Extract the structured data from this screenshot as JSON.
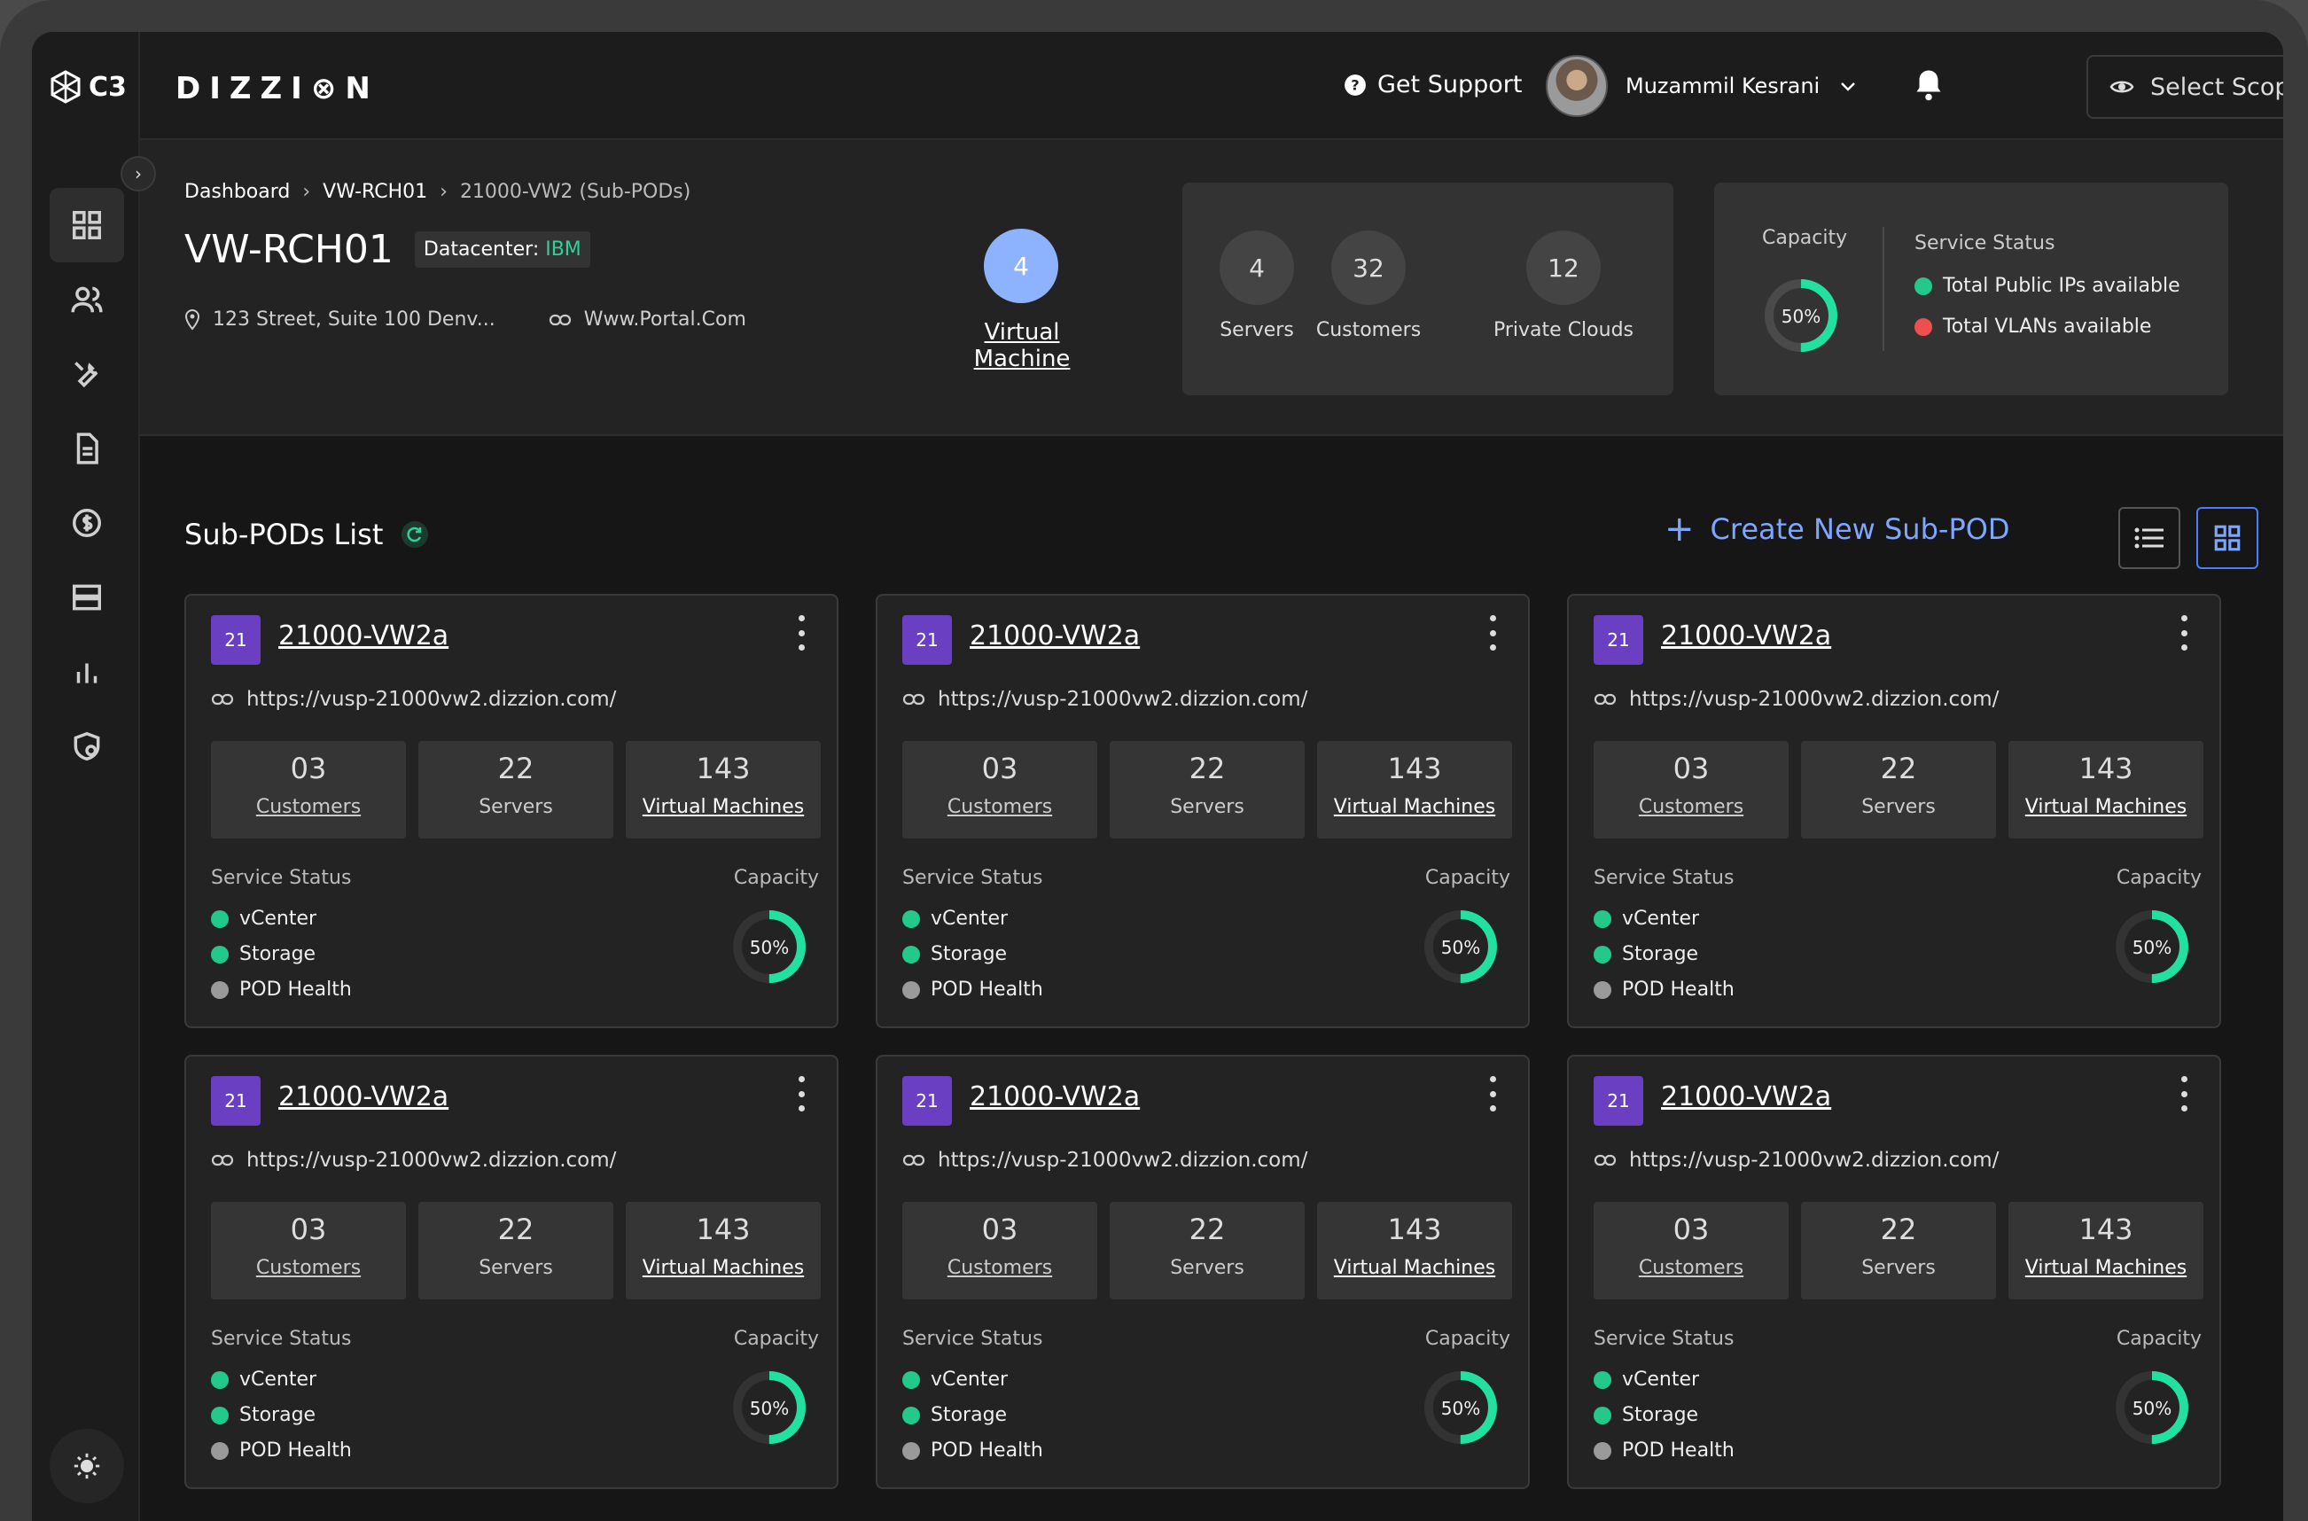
{
  "app": {
    "logo_text": "C3",
    "brand": "DIZZI⊗N"
  },
  "topbar": {
    "support_label": "Get Support",
    "user_name": "Muzammil Kesrani",
    "scope_label": "Select Scope"
  },
  "sidebar": {
    "items": [
      {
        "icon": "dashboard-icon",
        "active": true
      },
      {
        "icon": "users-icon"
      },
      {
        "icon": "tools-icon"
      },
      {
        "icon": "document-icon"
      },
      {
        "icon": "billing-icon"
      },
      {
        "icon": "servers-icon"
      },
      {
        "icon": "chart-icon"
      },
      {
        "icon": "security-icon"
      }
    ]
  },
  "breadcrumb": {
    "items": [
      "Dashboard",
      "VW-RCH01",
      "21000-VW2 (Sub-PODs)"
    ]
  },
  "pod": {
    "title": "VW-RCH01",
    "datacenter_prefix": "Datacenter: ",
    "datacenter": "IBM",
    "address": "123 Street, Suite 100 Denv...",
    "website": "Www.Portal.Com",
    "vm_count": "4",
    "vm_label": "Virtual Machine"
  },
  "stats": {
    "servers": {
      "value": "4",
      "label": "Servers"
    },
    "customers": {
      "value": "32",
      "label": "Customers"
    },
    "private_clouds": {
      "value": "12",
      "label": "Private Clouds"
    }
  },
  "capacity_panel": {
    "title": "Capacity",
    "percent_text": "50%",
    "percent": 50,
    "service_status_title": "Service Status",
    "items": [
      {
        "label": "Total Public IPs available",
        "color": "#22c98a"
      },
      {
        "label": "Total VLANs available",
        "color": "#ef4f4f"
      }
    ]
  },
  "subpods": {
    "title": "Sub-PODs List",
    "create_label": "Create New Sub-POD",
    "cards": [
      {
        "badge": "21",
        "name": "21000-VW2a",
        "url": "https://vusp-21000vw2.dizzion.com/",
        "customers": "03",
        "customers_label": "Customers",
        "servers": "22",
        "servers_label": "Servers",
        "vms": "143",
        "vms_label": "Virtual Machines",
        "status_label": "Service Status",
        "capacity_label": "Capacity",
        "capacity_text": "50%",
        "capacity": 50,
        "services": [
          "vCenter",
          "Storage",
          "POD Health"
        ]
      },
      {
        "badge": "21",
        "name": "21000-VW2a",
        "url": "https://vusp-21000vw2.dizzion.com/",
        "customers": "03",
        "customers_label": "Customers",
        "servers": "22",
        "servers_label": "Servers",
        "vms": "143",
        "vms_label": "Virtual Machines",
        "status_label": "Service Status",
        "capacity_label": "Capacity",
        "capacity_text": "50%",
        "capacity": 50,
        "services": [
          "vCenter",
          "Storage",
          "POD Health"
        ]
      },
      {
        "badge": "21",
        "name": "21000-VW2a",
        "url": "https://vusp-21000vw2.dizzion.com/",
        "customers": "03",
        "customers_label": "Customers",
        "servers": "22",
        "servers_label": "Servers",
        "vms": "143",
        "vms_label": "Virtual Machines",
        "status_label": "Service Status",
        "capacity_label": "Capacity",
        "capacity_text": "50%",
        "capacity": 50,
        "services": [
          "vCenter",
          "Storage",
          "POD Health"
        ]
      },
      {
        "badge": "21",
        "name": "21000-VW2a",
        "url": "https://vusp-21000vw2.dizzion.com/",
        "customers": "03",
        "customers_label": "Customers",
        "servers": "22",
        "servers_label": "Servers",
        "vms": "143",
        "vms_label": "Virtual Machines",
        "status_label": "Service Status",
        "capacity_label": "Capacity",
        "capacity_text": "50%",
        "capacity": 50,
        "services": [
          "vCenter",
          "Storage",
          "POD Health"
        ]
      },
      {
        "badge": "21",
        "name": "21000-VW2a",
        "url": "https://vusp-21000vw2.dizzion.com/",
        "customers": "03",
        "customers_label": "Customers",
        "servers": "22",
        "servers_label": "Servers",
        "vms": "143",
        "vms_label": "Virtual Machines",
        "status_label": "Service Status",
        "capacity_label": "Capacity",
        "capacity_text": "50%",
        "capacity": 50,
        "services": [
          "vCenter",
          "Storage",
          "POD Health"
        ]
      },
      {
        "badge": "21",
        "name": "21000-VW2a",
        "url": "https://vusp-21000vw2.dizzion.com/",
        "customers": "03",
        "customers_label": "Customers",
        "servers": "22",
        "servers_label": "Servers",
        "vms": "143",
        "vms_label": "Virtual Machines",
        "status_label": "Service Status",
        "capacity_label": "Capacity",
        "capacity_text": "50%",
        "capacity": 50,
        "services": [
          "vCenter",
          "Storage",
          "POD Health"
        ]
      }
    ]
  },
  "colors": {
    "accent": "#7ea6ff",
    "ok": "#22c98a",
    "error": "#ef4f4f",
    "idle": "#9a9a9a",
    "badge": "#6a3fc1",
    "ring": "#22e0a0"
  }
}
